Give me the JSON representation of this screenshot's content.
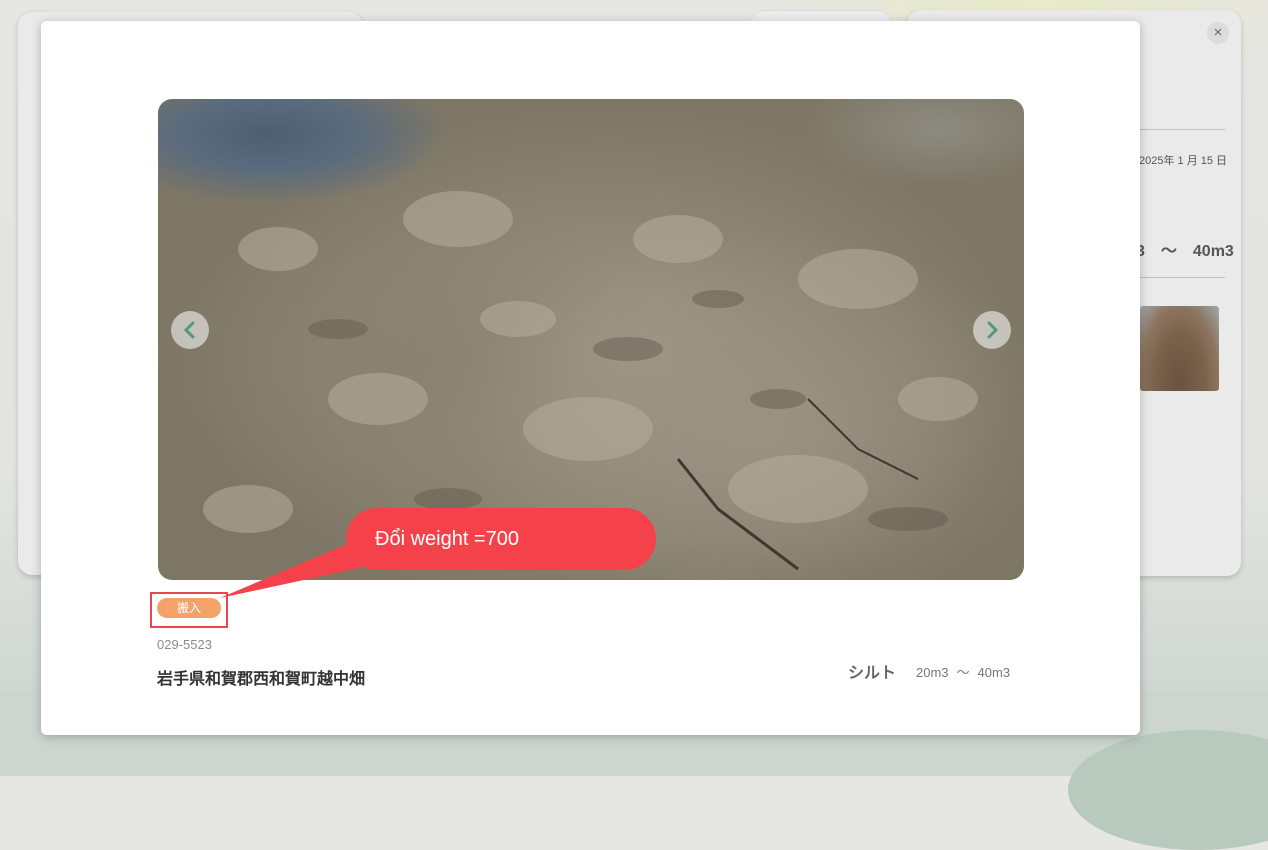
{
  "background": {
    "right_card": {
      "close_glyph": "×",
      "date": "2025年 1 月 15 日",
      "volume": "3　～　40m3"
    }
  },
  "modal": {
    "badge": "搬入",
    "postal_code": "029-5523",
    "address": "岩手県和賀郡西和賀町越中畑",
    "soil_type": "シルト",
    "volume_min": "20m3",
    "volume_separator": "～",
    "volume_max": "40m3",
    "icons": {
      "prev": "chevron-left-icon",
      "next": "chevron-right-icon"
    }
  },
  "annotation": {
    "text": "Đổi weight =700",
    "color": "#f5424a"
  },
  "colors": {
    "badge": "#f3a36a",
    "arrow": "#4f9a7a",
    "highlight_box": "#e8484a"
  }
}
